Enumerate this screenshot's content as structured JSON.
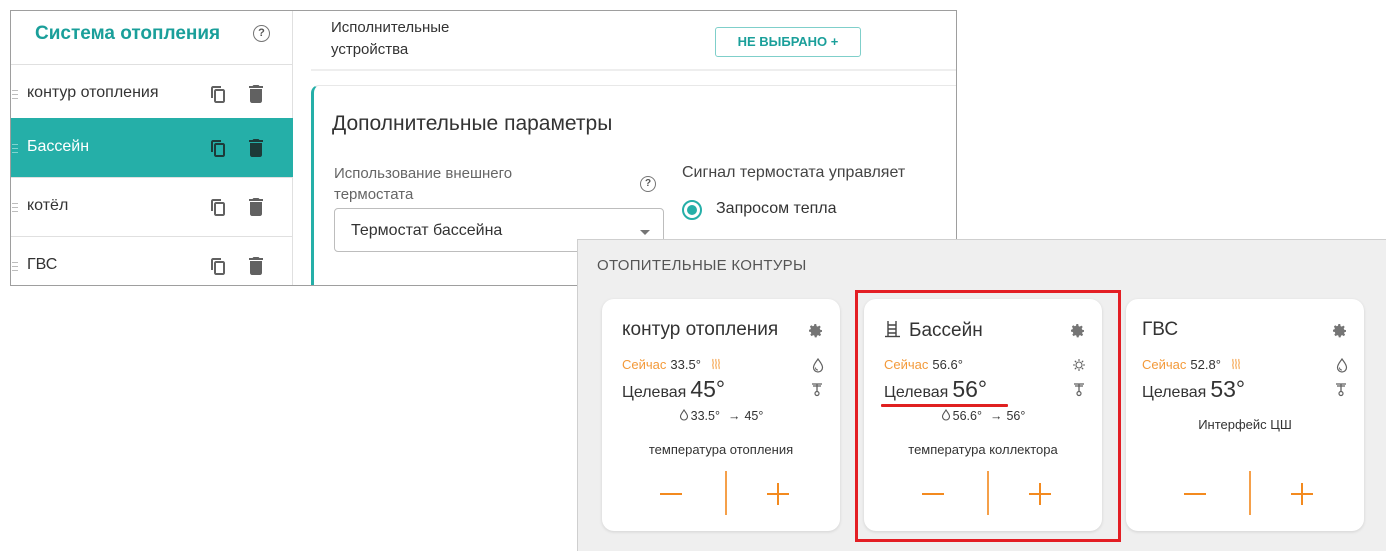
{
  "system": {
    "title": "Система отопления",
    "help": "?",
    "items": [
      {
        "label": "контур отопления",
        "active": false
      },
      {
        "label": "Бассейн",
        "active": true
      },
      {
        "label": "котёл",
        "active": false
      },
      {
        "label": "ГВС",
        "active": false
      }
    ]
  },
  "actuators": {
    "label": "Исполнительные устройства",
    "button": "НЕ ВЫБРАНО  +"
  },
  "params": {
    "title": "Дополнительные параметры",
    "external_label": "Использование внешнего термостата",
    "help": "?",
    "select_value": "Термостат бассейна",
    "signal_label": "Сигнал термостата управляет",
    "radio_label": "Запросом тепла"
  },
  "overlay": {
    "title": "ОТОПИТЕЛЬНЫЕ КОНТУРЫ",
    "cards": [
      {
        "name": "контур отопления",
        "now_label": "Сейчас",
        "now_value": "33.5°",
        "target_label": "Целевая",
        "target_value": "45°",
        "trend_from": "33.5°",
        "trend_arrow": "→",
        "trend_to": "45°",
        "description": "температура отопления"
      },
      {
        "name": "Бассейн",
        "now_label": "Сейчас",
        "now_value": "56.6°",
        "target_label": "Целевая",
        "target_value": "56°",
        "trend_from": "56.6°",
        "trend_arrow": "→",
        "trend_to": "56°",
        "description": "температура коллектора"
      },
      {
        "name": "ГВС",
        "now_label": "Сейчас",
        "now_value": "52.8°",
        "target_label": "Целевая",
        "target_value": "53°",
        "description": "Интерфейс ЦШ"
      }
    ]
  },
  "colors": {
    "teal": "#25afa8",
    "orange": "#f38a1f",
    "highlight_red": "#e31e24"
  },
  "icons": [
    "help-icon",
    "drag-handle-icon",
    "copy-icon",
    "trash-icon",
    "gear-icon",
    "pool-icon",
    "heating-waves-icon",
    "water-drop-icon",
    "thermometer-icon",
    "flame-sensor-icon",
    "dropdown-arrow-icon"
  ]
}
